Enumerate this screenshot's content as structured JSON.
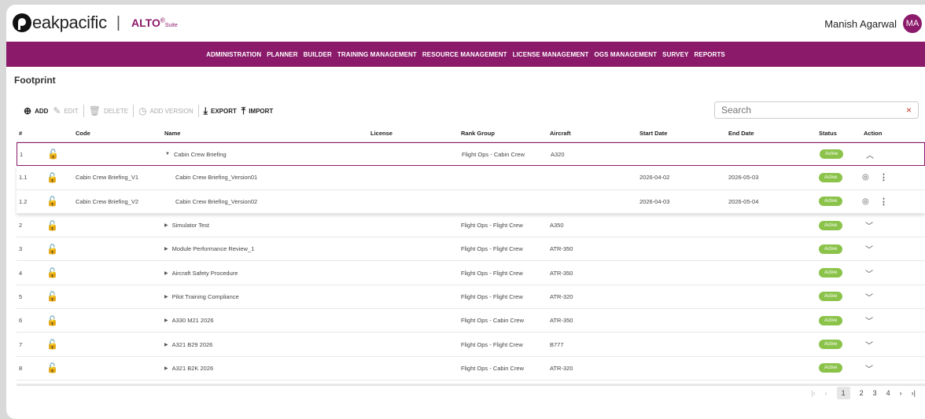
{
  "brand": {
    "name": "eakpacific",
    "product": "ALTO",
    "product_mark": "©",
    "product_suffix": "Suite",
    "separator": "|"
  },
  "user": {
    "name": "Manish Agarwal",
    "initials": "MA"
  },
  "nav": [
    "ADMINISTRATION",
    "PLANNER",
    "BUILDER",
    "TRAINING MANAGEMENT",
    "RESOURCE MANAGEMENT",
    "LICENSE MANAGEMENT",
    "OGS MANAGEMENT",
    "SURVEY",
    "REPORTS"
  ],
  "page_title": "Footprint",
  "toolbar": {
    "add": "ADD",
    "edit": "EDIT",
    "delete": "DELETE",
    "add_version": "ADD VERSION",
    "export": "EXPORT",
    "import": "IMPORT"
  },
  "search": {
    "placeholder": "Search",
    "clear": "×"
  },
  "columns": [
    "#",
    "Code",
    "Name",
    "License",
    "Rank Group",
    "Aircraft",
    "Start Date",
    "End Date",
    "Status",
    "Action"
  ],
  "rows": [
    {
      "num": "1",
      "code": "",
      "name": "Cabin Crew Briefing",
      "rank": "Flight Ops - Cabin Crew",
      "aircraft": "A320",
      "start": "",
      "end": "",
      "status": "Active",
      "expanded": true
    },
    {
      "num": "1.1",
      "code": "Cabin Crew Briefing_V1",
      "name": "Cabin Crew Briefing_Version01",
      "rank": "",
      "aircraft": "",
      "start": "2026-04-02",
      "end": "2026-05-03",
      "status": "Active",
      "child": true
    },
    {
      "num": "1.2",
      "code": "Cabin Crew Briefing_V2",
      "name": "Cabin Crew Briefing_Version02",
      "rank": "",
      "aircraft": "",
      "start": "2026-04-03",
      "end": "2026-05-04",
      "status": "Active",
      "child": true
    },
    {
      "num": "2",
      "code": "",
      "name": "Simulator Test",
      "rank": "Flight Ops - Flight Crew",
      "aircraft": "A350",
      "start": "",
      "end": "",
      "status": "Active"
    },
    {
      "num": "3",
      "code": "",
      "name": "Module Performance Review_1",
      "rank": "Flight Ops - Flight Crew",
      "aircraft": "ATR-350",
      "start": "",
      "end": "",
      "status": "Active"
    },
    {
      "num": "4",
      "code": "",
      "name": "Aircraft Safety Procedure",
      "rank": "Flight Ops - Flight Crew",
      "aircraft": "ATR-350",
      "start": "",
      "end": "",
      "status": "Active"
    },
    {
      "num": "5",
      "code": "",
      "name": "Pilot Training Compliance",
      "rank": "Flight Ops - Flight Crew",
      "aircraft": "ATR-320",
      "start": "",
      "end": "",
      "status": "Active"
    },
    {
      "num": "6",
      "code": "",
      "name": "A330 M21 2026",
      "rank": "Flight Ops - Cabin Crew",
      "aircraft": "ATR-350",
      "start": "",
      "end": "",
      "status": "Active"
    },
    {
      "num": "7",
      "code": "",
      "name": "A321 B29 2026",
      "rank": "Flight Ops - Flight Crew",
      "aircraft": "B777",
      "start": "",
      "end": "",
      "status": "Active"
    },
    {
      "num": "8",
      "code": "",
      "name": "A321 B2K 2026",
      "rank": "Flight Ops - Cabin Crew",
      "aircraft": "ATR-320",
      "start": "",
      "end": "",
      "status": "Active"
    }
  ],
  "pagination": {
    "pages": [
      "1",
      "2",
      "3",
      "4"
    ],
    "current": "1"
  }
}
